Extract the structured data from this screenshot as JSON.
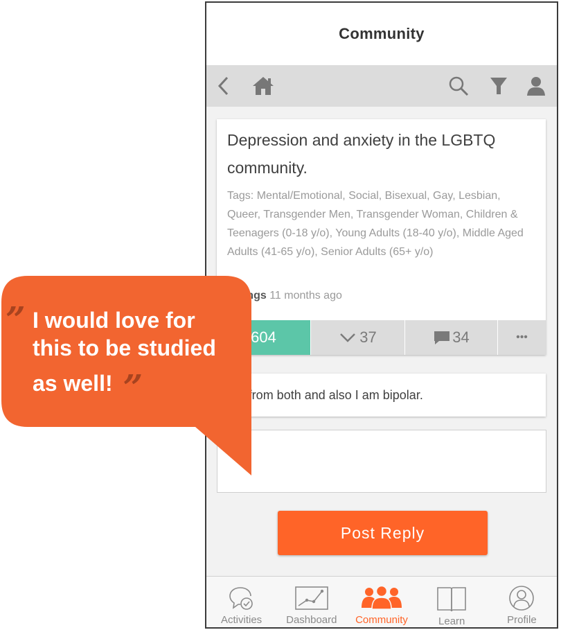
{
  "header": {
    "title": "Community"
  },
  "toolbar": {
    "back_icon": "chevron-left-icon",
    "home_icon": "home-icon",
    "search_icon": "search-icon",
    "filter_icon": "filter-icon",
    "user_icon": "user-icon"
  },
  "post": {
    "title": "Depression and anxiety in the LGBTQ community.",
    "tags": "Tags: Mental/Emotional, Social, Bisexual, Gay, Lesbian, Queer, Transgender Men, Transgender Woman, Children & Teenagers (0-18 y/o), Young Adults (18-40 y/o), Middle Aged Adults (41-65 y/o), Senior Adults (65+ y/o)",
    "author": "eWings",
    "time": "11 months ago",
    "upvotes": "604",
    "downvotes": "37",
    "comments": "34",
    "more": "•••"
  },
  "reply": {
    "text": "ffer from both and also I am bipolar."
  },
  "reply_input": {
    "value": "",
    "placeholder": ""
  },
  "post_button": {
    "label": "Post Reply"
  },
  "bottom_nav": {
    "items": [
      {
        "label": "Activities",
        "icon": "activities-icon"
      },
      {
        "label": "Dashboard",
        "icon": "dashboard-icon"
      },
      {
        "label": "Community",
        "icon": "community-icon"
      },
      {
        "label": "Learn",
        "icon": "learn-icon"
      },
      {
        "label": "Profile",
        "icon": "profile-icon"
      }
    ],
    "active": "Community"
  },
  "callout": {
    "line1": "I would love for",
    "line2": "this to be studied",
    "line3": "as well!",
    "open_quote": "”",
    "close_quote": "”"
  },
  "colors": {
    "accent": "#ff6428",
    "upvote": "#5cc6a8",
    "toolbar": "#dcdcdc",
    "bubble": "#f26530"
  }
}
